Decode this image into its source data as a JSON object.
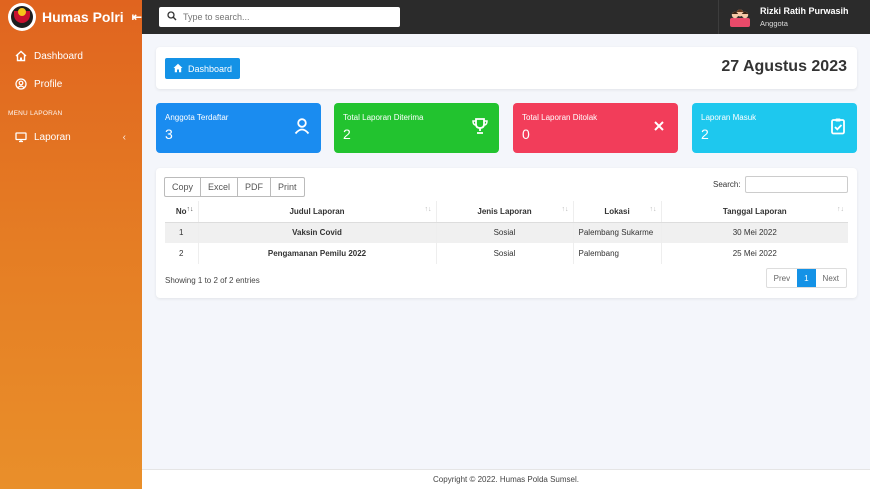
{
  "sidebar": {
    "brand": "Humas Polri",
    "items": [
      {
        "label": "Dashboard",
        "icon": "home-icon"
      },
      {
        "label": "Profile",
        "icon": "user-circle-icon"
      }
    ],
    "section": "MENU LAPORAN",
    "laporan": {
      "label": "Laporan",
      "icon": "monitor-icon"
    }
  },
  "topbar": {
    "search_placeholder": "Type to search...",
    "user_name": "Rizki Ratih Purwasih",
    "user_role": "Anggota"
  },
  "header": {
    "button_label": "Dashboard",
    "date": "27 Agustus 2023"
  },
  "stats": [
    {
      "label": "Anggota Terdaftar",
      "value": "3",
      "color": "#1a8cf0",
      "icon": "user-icon"
    },
    {
      "label": "Total Laporan Diterima",
      "value": "2",
      "color": "#22c32f",
      "icon": "trophy-icon"
    },
    {
      "label": "Total Laporan Ditolak",
      "value": "0",
      "color": "#f23d5a",
      "icon": "close-icon"
    },
    {
      "label": "Laporan Masuk",
      "value": "2",
      "color": "#1ec8ee",
      "icon": "clipboard-check-icon"
    }
  ],
  "table": {
    "buttons": [
      "Copy",
      "Excel",
      "PDF",
      "Print"
    ],
    "search_label": "Search:",
    "columns": [
      "No",
      "Judul Laporan",
      "Jenis Laporan",
      "Lokasi",
      "Tanggal Laporan"
    ],
    "rows": [
      [
        "1",
        "Vaksin Covid",
        "Sosial",
        "Palembang Sukarme",
        "30 Mei 2022"
      ],
      [
        "2",
        "Pengamanan Pemilu 2022",
        "Sosial",
        "Palembang",
        "25 Mei 2022"
      ]
    ],
    "info": "Showing 1 to 2 of 2 entries",
    "pager": {
      "prev": "Prev",
      "current": "1",
      "next": "Next"
    }
  },
  "footer": "Copyright © 2022. Humas Polda Sumsel."
}
